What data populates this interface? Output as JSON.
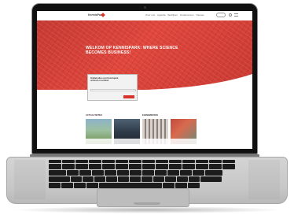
{
  "website": {
    "logo_text": "KennisPark",
    "nav_items": [
      "Over ons",
      "Agenda",
      "Bedrijven",
      "Ondernemen",
      "Nieuws",
      "Contact"
    ],
    "hero_title": "WELKOM OP KENNISPARK: WHERE SCIENCE BECOMES BUSINESS!",
    "card_text": "Ontdek alles over Kennispark, ontmoet en verbind",
    "section_labels": [
      "ACTUALITEITEN",
      "EVENEMENTEN"
    ],
    "accent_color": "#d9342b"
  }
}
